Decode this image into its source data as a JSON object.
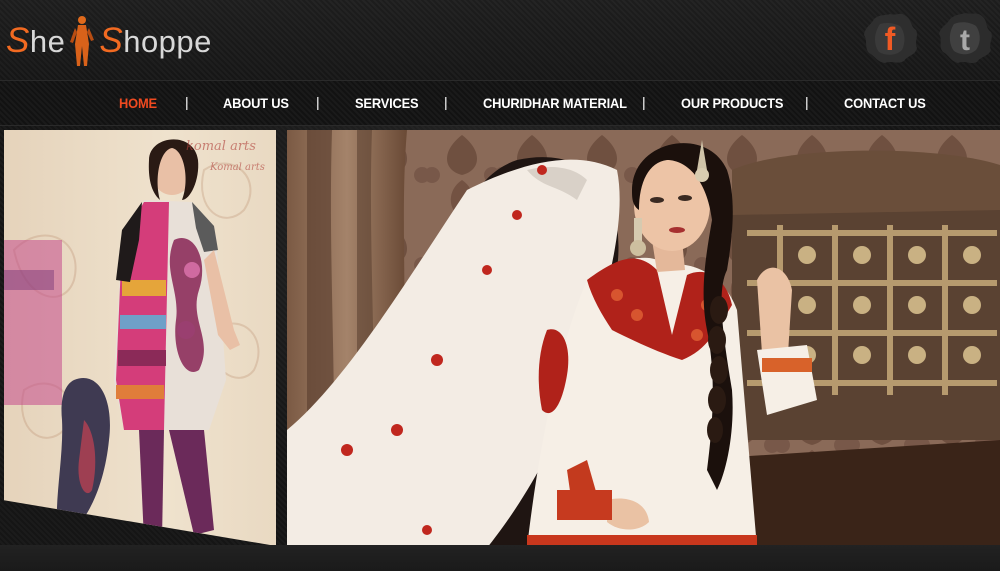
{
  "brand": {
    "logo_part1_cap": "S",
    "logo_part1_rest": "he",
    "logo_part2_cap": "S",
    "logo_part2_rest": "hoppe",
    "accent_color": "#f26a21"
  },
  "social": {
    "facebook_icon": "facebook-icon",
    "twitter_icon": "twitter-icon"
  },
  "nav": {
    "active_color": "#f04a20",
    "separator": "|",
    "items": [
      {
        "label": "HOME",
        "active": true
      },
      {
        "label": "ABOUT US",
        "active": false
      },
      {
        "label": "SERVICES",
        "active": false
      },
      {
        "label": "CHURIDHAR MATERIAL",
        "active": false
      },
      {
        "label": "OUR PRODUCTS",
        "active": false
      },
      {
        "label": "CONTACT US",
        "active": false
      }
    ]
  },
  "slider": {
    "left_watermark_line1": "komal arts",
    "left_watermark_line2": "Komal arts",
    "main_image": "model-white-anarkali-suit",
    "left_image": "model-printed-kurti"
  }
}
